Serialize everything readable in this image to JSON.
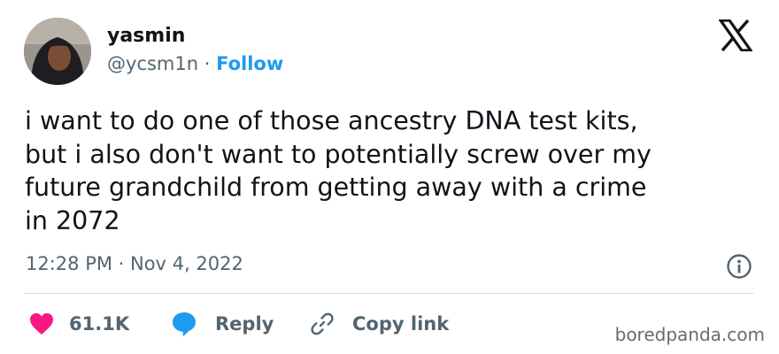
{
  "author": {
    "name": "yasmin",
    "handle": "@ycsm1n",
    "separator": "·",
    "follow_label": "Follow"
  },
  "tweet": {
    "lines": [
      "i want to do one of those ancestry DNA test kits,",
      "but i also don't want to potentially screw over my",
      "future grandchild from getting away with a crime",
      "in 2072"
    ],
    "timestamp": "12:28 PM · Nov 4, 2022"
  },
  "actions": {
    "likes": "61.1K",
    "reply_label": "Reply",
    "copy_link_label": "Copy link"
  },
  "watermark": "boredpanda.com",
  "colors": {
    "accent": "#1d9bf0",
    "like": "#f91880",
    "text": "#0f1419",
    "secondary": "#536471",
    "divider": "#cfd9de"
  },
  "icons": [
    "x-logo-icon",
    "info-icon",
    "heart-icon",
    "reply-bubble-icon",
    "link-icon"
  ]
}
